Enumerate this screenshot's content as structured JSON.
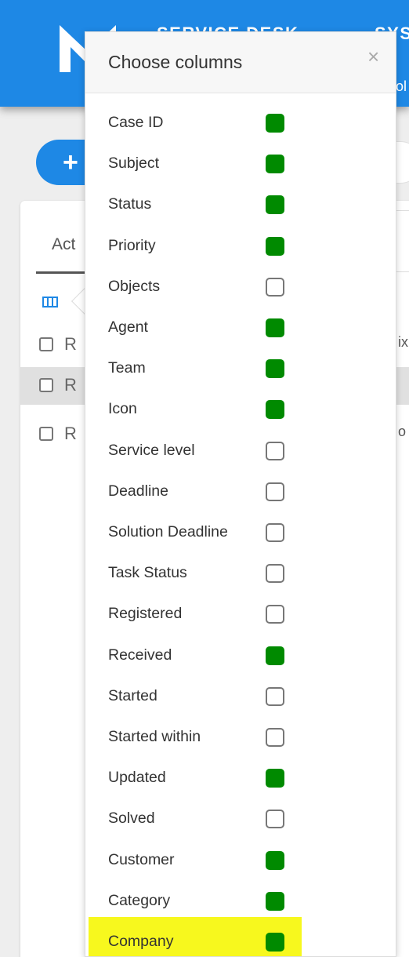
{
  "header": {
    "title": "SERVICE DESK",
    "title_partial": "SYS",
    "subtitle_partial": "ol"
  },
  "main": {
    "new_button_label": "+",
    "active_tab": "Act",
    "rows": [
      {
        "text": "R",
        "right": "ix"
      },
      {
        "text": "R",
        "right": ""
      },
      {
        "text": "R",
        "right": "o"
      }
    ]
  },
  "popover": {
    "title": "Choose columns",
    "close_glyph": "×",
    "columns": [
      {
        "label": "Case ID",
        "checked": true
      },
      {
        "label": "Subject",
        "checked": true
      },
      {
        "label": "Status",
        "checked": true
      },
      {
        "label": "Priority",
        "checked": true
      },
      {
        "label": "Objects",
        "checked": false
      },
      {
        "label": "Agent",
        "checked": true
      },
      {
        "label": "Team",
        "checked": true
      },
      {
        "label": "Icon",
        "checked": true
      },
      {
        "label": "Service level",
        "checked": false
      },
      {
        "label": "Deadline",
        "checked": false
      },
      {
        "label": "Solution Deadline",
        "checked": false
      },
      {
        "label": "Task Status",
        "checked": false
      },
      {
        "label": "Registered",
        "checked": false
      },
      {
        "label": "Received",
        "checked": true
      },
      {
        "label": "Started",
        "checked": false
      },
      {
        "label": "Started within",
        "checked": false
      },
      {
        "label": "Updated",
        "checked": true
      },
      {
        "label": "Solved",
        "checked": false
      },
      {
        "label": "Customer",
        "checked": true
      },
      {
        "label": "Category",
        "checked": true
      },
      {
        "label": "Company",
        "checked": true,
        "highlighted": true
      }
    ]
  },
  "colors": {
    "brand_blue": "#1e88e5",
    "checked_green": "#008a00",
    "highlight_yellow": "#f7f81e"
  }
}
